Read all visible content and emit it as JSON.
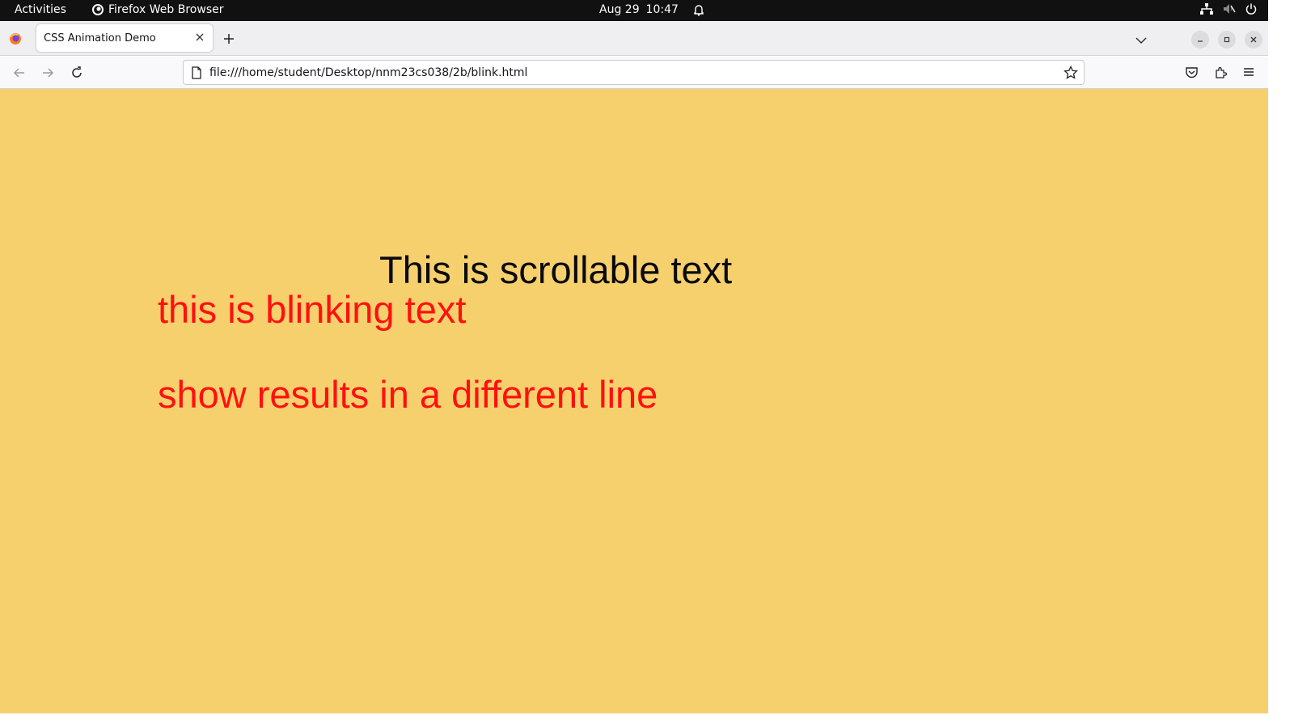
{
  "topbar": {
    "activities": "Activities",
    "app_name": "Firefox Web Browser",
    "date": "Aug 29",
    "time": "10:47"
  },
  "browser": {
    "tab_title": "CSS Animation Demo",
    "url": "file:///home/student/Desktop/nnm23cs038/2b/blink.html"
  },
  "page": {
    "scrollable_text": "This is scrollable text",
    "blinking_text": "this is blinking text",
    "result_text": "show results in a different line"
  },
  "colors": {
    "page_background": "#f7d06e",
    "scroll_text": "#0a0a0a",
    "blink_text": "#ff1010"
  },
  "icons": {
    "topbar": [
      "firefox-icon",
      "bell-icon",
      "network-icon",
      "volume-muted-icon",
      "power-icon"
    ],
    "toolbar": [
      "back-icon",
      "forward-icon",
      "reload-icon",
      "page-icon",
      "bookmark-star-icon",
      "pocket-icon",
      "extensions-icon",
      "menu-icon"
    ]
  }
}
